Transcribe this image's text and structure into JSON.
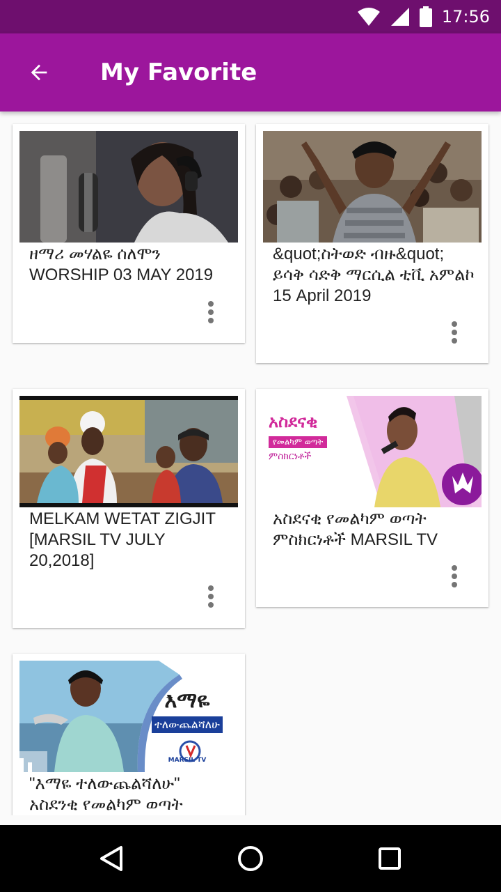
{
  "status_bar": {
    "time": "17:56",
    "icons": [
      "wifi-icon",
      "signal-icon",
      "battery-icon"
    ]
  },
  "app_bar": {
    "title": "My Favorite",
    "back_icon": "arrow-back-icon"
  },
  "videos": [
    {
      "title": "ዘማሪ መሃልዬ ሰለሞን WORSHIP 03 MAY 2019",
      "thumbnail": "singer at studio microphone with headphones"
    },
    {
      "title": "&quot;ስትወድ ብዙ&quot; ይሳቅ ሳድቅ ማርሲል ቲቪ አምልኮ 15 April 2019",
      "thumbnail": "man worshipping with raised hands in crowd"
    },
    {
      "title": "MELKAM WETAT ZIGJIT [MARSIL TV JULY 20,2018]",
      "thumbnail": "outdoor gathering of people"
    },
    {
      "title": "አስደናቂ የመልካም ወጣት ምስክርነቶች MARSIL TV",
      "thumbnail_text": [
        "አስደናቂ",
        "የመልካም ወጣት",
        "ምስክርነቶች"
      ]
    },
    {
      "title": "\"እማዬ ተለውጨልሻለሁ\" አስደንቂ የመልካም ወጣት",
      "thumbnail_text": [
        "እማዬ",
        "ተለውጨልሻለሁ",
        "MARSIL TV"
      ]
    }
  ],
  "nav_bar": {
    "icons": [
      "back-triangle-icon",
      "home-circle-icon",
      "recents-square-icon"
    ]
  },
  "colors": {
    "status_bar": "#6e0f6e",
    "app_bar": "#9c169c",
    "background": "#fafafa"
  }
}
